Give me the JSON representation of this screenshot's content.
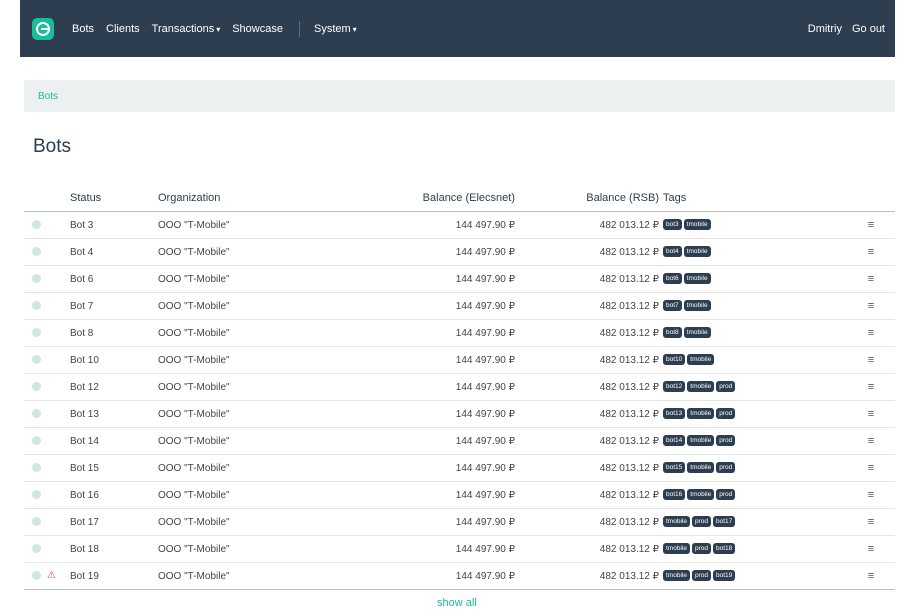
{
  "nav": {
    "items": [
      {
        "label": "Bots",
        "caret": false
      },
      {
        "label": "Clients",
        "caret": false
      },
      {
        "label": "Transactions",
        "caret": true
      },
      {
        "label": "Showcase",
        "caret": false
      }
    ],
    "system_label": "System",
    "user": "Dmitriy",
    "logout": "Go out",
    "colors": {
      "bar": "#2c3e50",
      "accent": "#18bc9c"
    }
  },
  "breadcrumb": {
    "current": "Bots"
  },
  "page_title": "Bots",
  "table": {
    "headers": {
      "status": "Status",
      "organization": "Organization",
      "balance_elecsnet": "Balance (Elecsnet)",
      "balance_rsb": "Balance (RSB)",
      "tags": "Tags"
    },
    "rows": [
      {
        "name": "Bot 3",
        "org": "OOO \"T-Mobile\"",
        "elecsnet": "144 497.90 ₽",
        "rsb": "482 013.12 ₽",
        "tags": [
          "bot3",
          "tmobile"
        ],
        "warning": false
      },
      {
        "name": "Bot 4",
        "org": "OOO \"T-Mobile\"",
        "elecsnet": "144 497.90 ₽",
        "rsb": "482 013.12 ₽",
        "tags": [
          "bot4",
          "tmobile"
        ],
        "warning": false
      },
      {
        "name": "Bot 6",
        "org": "OOO \"T-Mobile\"",
        "elecsnet": "144 497.90 ₽",
        "rsb": "482 013.12 ₽",
        "tags": [
          "bot6",
          "tmobile"
        ],
        "warning": false
      },
      {
        "name": "Bot 7",
        "org": "OOO \"T-Mobile\"",
        "elecsnet": "144 497.90 ₽",
        "rsb": "482 013.12 ₽",
        "tags": [
          "bot7",
          "tmobile"
        ],
        "warning": false
      },
      {
        "name": "Bot 8",
        "org": "OOO \"T-Mobile\"",
        "elecsnet": "144 497.90 ₽",
        "rsb": "482 013.12 ₽",
        "tags": [
          "bot8",
          "tmobile"
        ],
        "warning": false
      },
      {
        "name": "Bot 10",
        "org": "OOO \"T-Mobile\"",
        "elecsnet": "144 497.90 ₽",
        "rsb": "482 013.12 ₽",
        "tags": [
          "bot10",
          "tmobile"
        ],
        "warning": false
      },
      {
        "name": "Bot 12",
        "org": "OOO \"T-Mobile\"",
        "elecsnet": "144 497.90 ₽",
        "rsb": "482 013.12 ₽",
        "tags": [
          "bot12",
          "tmobile",
          "prod"
        ],
        "warning": false
      },
      {
        "name": "Bot 13",
        "org": "OOO \"T-Mobile\"",
        "elecsnet": "144 497.90 ₽",
        "rsb": "482 013.12 ₽",
        "tags": [
          "bot13",
          "tmobile",
          "prod"
        ],
        "warning": false
      },
      {
        "name": "Bot 14",
        "org": "OOO \"T-Mobile\"",
        "elecsnet": "144 497.90 ₽",
        "rsb": "482 013.12 ₽",
        "tags": [
          "bot14",
          "tmobile",
          "prod"
        ],
        "warning": false
      },
      {
        "name": "Bot 15",
        "org": "OOO \"T-Mobile\"",
        "elecsnet": "144 497.90 ₽",
        "rsb": "482 013.12 ₽",
        "tags": [
          "bot15",
          "tmobile",
          "prod"
        ],
        "warning": false
      },
      {
        "name": "Bot 16",
        "org": "OOO \"T-Mobile\"",
        "elecsnet": "144 497.90 ₽",
        "rsb": "482 013.12 ₽",
        "tags": [
          "bot16",
          "tmobile",
          "prod"
        ],
        "warning": false
      },
      {
        "name": "Bot 17",
        "org": "OOO \"T-Mobile\"",
        "elecsnet": "144 497.90 ₽",
        "rsb": "482 013.12 ₽",
        "tags": [
          "tmobile",
          "prod",
          "bot17"
        ],
        "warning": false
      },
      {
        "name": "Bot 18",
        "org": "OOO \"T-Mobile\"",
        "elecsnet": "144 497.90 ₽",
        "rsb": "482 013.12 ₽",
        "tags": [
          "tmobile",
          "prod",
          "bot18"
        ],
        "warning": false
      },
      {
        "name": "Bot 19",
        "org": "OOO \"T-Mobile\"",
        "elecsnet": "144 497.90 ₽",
        "rsb": "482 013.12 ₽",
        "tags": [
          "tmobile",
          "prod",
          "bot19"
        ],
        "warning": true
      }
    ],
    "row_menu_icon": "hamburger-icon",
    "status_icon": "status-dot-icon",
    "warning_icon": "warning-triangle-icon"
  },
  "show_all": "show all"
}
